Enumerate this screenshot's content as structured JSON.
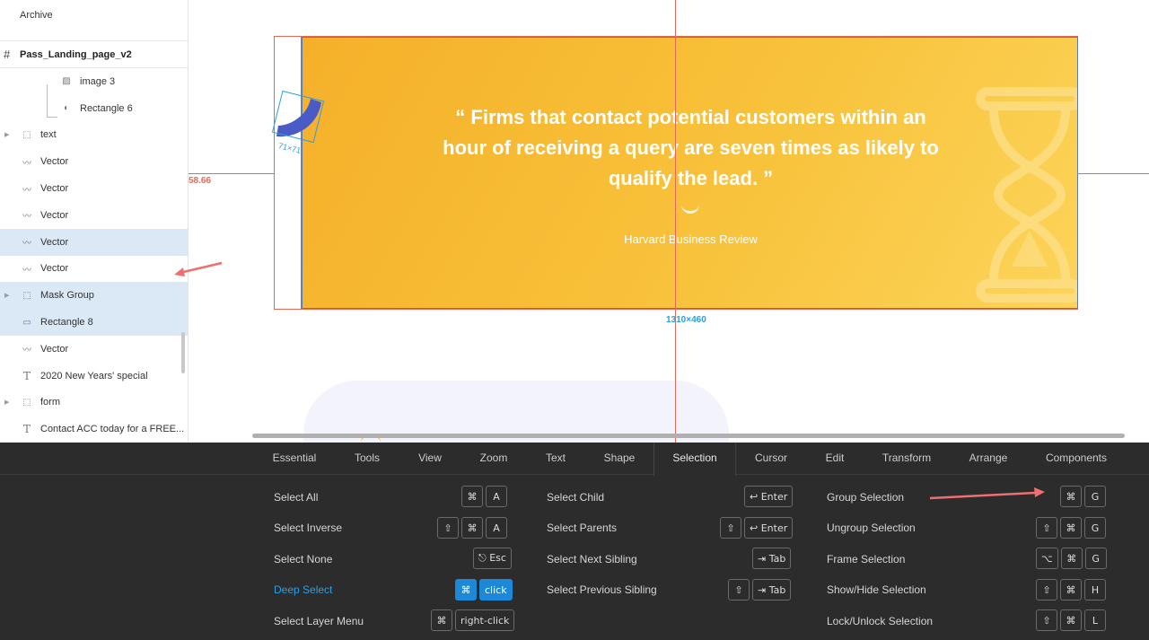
{
  "sidebar": {
    "archive_label": "Archive",
    "page_name": "Pass_Landing_page_v2",
    "layers": [
      {
        "label": "image 3",
        "icon": "image-icon"
      },
      {
        "label": "Rectangle 6",
        "icon": "half-circle-icon"
      },
      {
        "label": "text",
        "icon": "group-icon"
      },
      {
        "label": "Vector",
        "icon": "vector-icon"
      },
      {
        "label": "Vector",
        "icon": "vector-icon"
      },
      {
        "label": "Vector",
        "icon": "vector-icon"
      },
      {
        "label": "Vector",
        "icon": "vector-icon"
      },
      {
        "label": "Vector",
        "icon": "vector-icon"
      },
      {
        "label": "Mask Group",
        "icon": "group-icon"
      },
      {
        "label": "Rectangle 8",
        "icon": "rectangle-icon"
      },
      {
        "label": "Vector",
        "icon": "vector-icon"
      },
      {
        "label": "2020 New Years' special",
        "icon": "text-icon"
      },
      {
        "label": "form",
        "icon": "group-icon"
      },
      {
        "label": "Contact ACC today for a FREE...",
        "icon": "text-icon"
      }
    ]
  },
  "canvas": {
    "measure_left": "58.66",
    "measure_icon": "71×71",
    "measure_frame": "1310×460",
    "quote": "“ Firms that contact potential customers within an hour of receiving a query are seven times as likely to qualify the lead. ”",
    "source": "Harvard Business Review",
    "banner_color": "#f8c23a",
    "accent_color": "#2aa0e0"
  },
  "panel": {
    "tabs": [
      "Essential",
      "Tools",
      "View",
      "Zoom",
      "Text",
      "Shape",
      "Selection",
      "Cursor",
      "Edit",
      "Transform",
      "Arrange",
      "Components"
    ],
    "active_tab": "Selection",
    "col1": [
      {
        "label": "Select All",
        "keys": [
          "⌘",
          "A"
        ]
      },
      {
        "label": "Select Inverse",
        "keys": [
          "⇧",
          "⌘",
          "A"
        ]
      },
      {
        "label": "Select None",
        "keys": [
          "⎋ Esc"
        ]
      },
      {
        "label": "Deep Select",
        "keys": [
          "⌘",
          "click"
        ]
      },
      {
        "label": "Select Layer Menu",
        "keys": [
          "⌘",
          "right-click"
        ]
      }
    ],
    "col2": [
      {
        "label": "Select Child",
        "keys": [
          "↩ Enter"
        ]
      },
      {
        "label": "Select Parents",
        "keys": [
          "⇧",
          "↩ Enter"
        ]
      },
      {
        "label": "Select Next Sibling",
        "keys": [
          "⇥ Tab"
        ]
      },
      {
        "label": "Select Previous Sibling",
        "keys": [
          "⇧",
          "⇥ Tab"
        ]
      }
    ],
    "col3": [
      {
        "label": "Group Selection",
        "keys": [
          "⌘",
          "G"
        ]
      },
      {
        "label": "Ungroup Selection",
        "keys": [
          "⇧",
          "⌘",
          "G"
        ]
      },
      {
        "label": "Frame Selection",
        "keys": [
          "⌥",
          "⌘",
          "G"
        ]
      },
      {
        "label": "Show/Hide Selection",
        "keys": [
          "⇧",
          "⌘",
          "H"
        ]
      },
      {
        "label": "Lock/Unlock Selection",
        "keys": [
          "⇧",
          "⌘",
          "L"
        ]
      }
    ]
  }
}
